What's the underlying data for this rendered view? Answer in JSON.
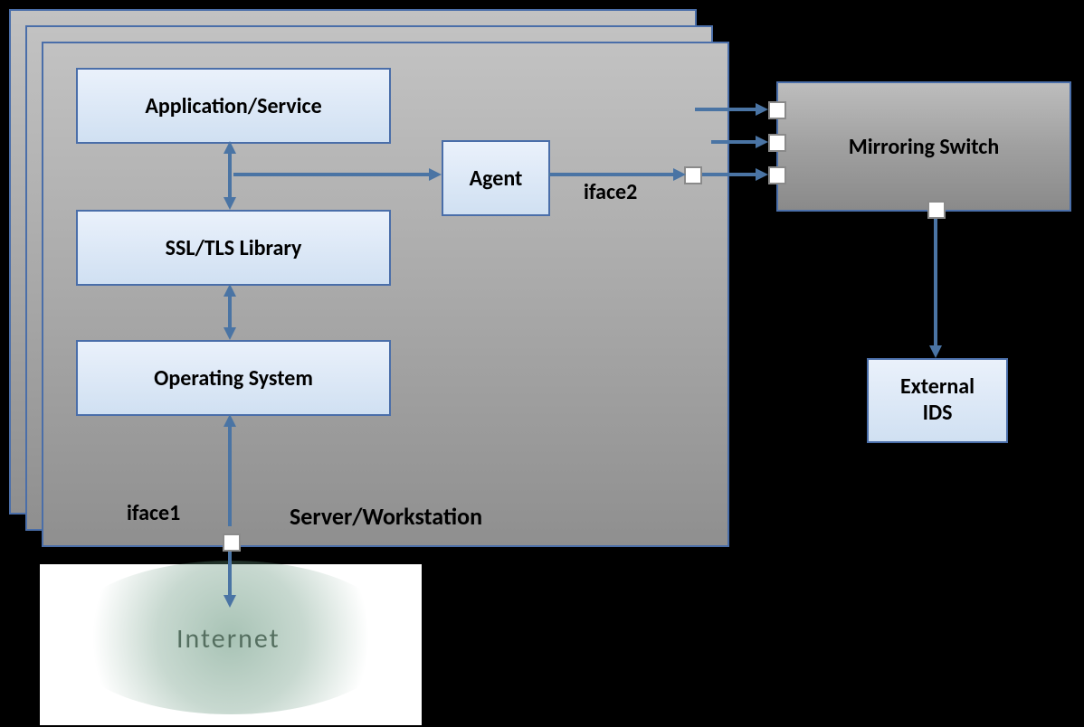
{
  "server": {
    "title": "Server/Workstation",
    "iface1_label": "iface1",
    "iface2_label": "iface2",
    "boxes": {
      "application": "Application/Service",
      "ssl": "SSL/TLS Library",
      "os": "Operating System",
      "agent": "Agent"
    }
  },
  "switch": {
    "label": "Mirroring Switch"
  },
  "ids": {
    "label": "External\nIDS"
  },
  "internet": {
    "label": "Internet"
  },
  "colors": {
    "arrow": "#4a74a4",
    "box_border": "#4a6ea9"
  }
}
